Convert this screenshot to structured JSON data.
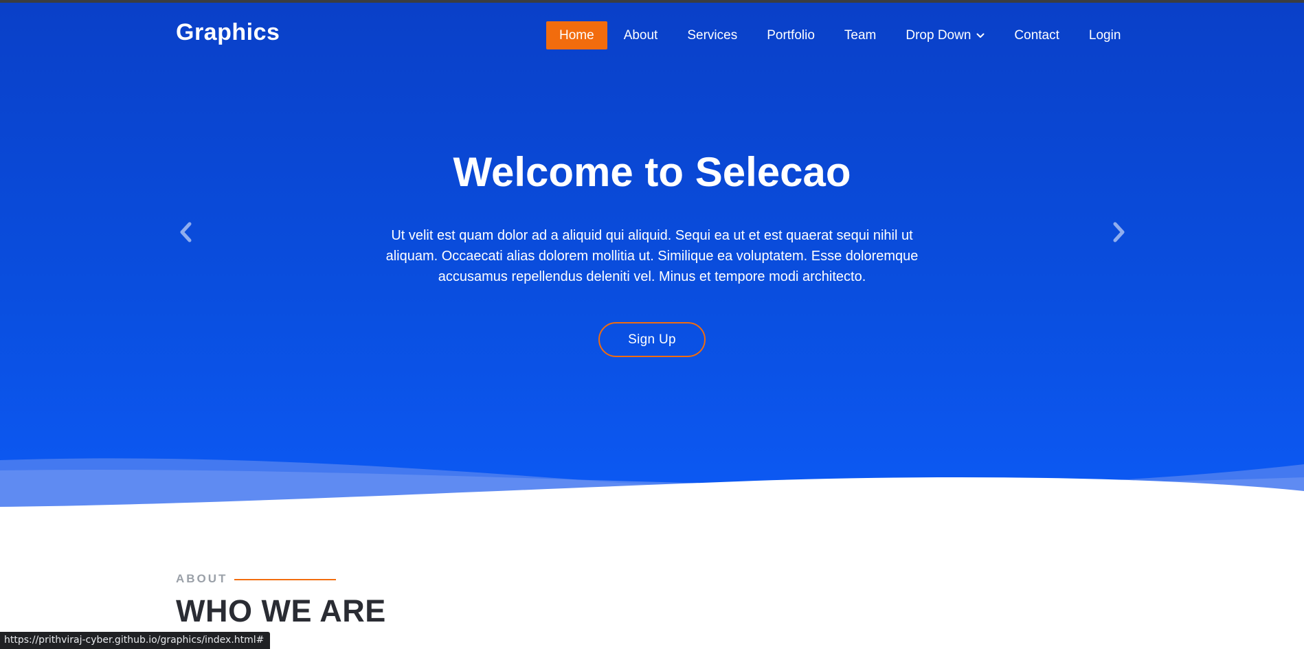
{
  "header": {
    "logo": "Graphics",
    "nav": [
      {
        "label": "Home",
        "active": true
      },
      {
        "label": "About"
      },
      {
        "label": "Services"
      },
      {
        "label": "Portfolio"
      },
      {
        "label": "Team"
      },
      {
        "label": "Drop Down",
        "icon": "chevron-down-icon"
      },
      {
        "label": "Contact"
      },
      {
        "label": "Login"
      }
    ]
  },
  "hero": {
    "title": "Welcome to Selecao",
    "text": "Ut velit est quam dolor ad a aliquid qui aliquid. Sequi ea ut et est quaerat sequi nihil ut aliquam. Occaecati alias dolorem mollitia ut. Similique ea voluptatem. Esse doloremque accusamus repellendus deleniti vel. Minus et tempore modi architecto.",
    "button": "Sign Up",
    "prev_icon": "chevron-left-icon",
    "next_icon": "chevron-right-icon"
  },
  "about": {
    "kicker": "ABOUT",
    "title": "WHO WE ARE"
  },
  "status_bar": {
    "url": "https://prithviraj-cyber.github.io/graphics/index.html#"
  },
  "colors": {
    "hero_blue": "#0a4fe0",
    "accent_orange": "#f26c0d",
    "heading_dark": "#2a2c33"
  }
}
